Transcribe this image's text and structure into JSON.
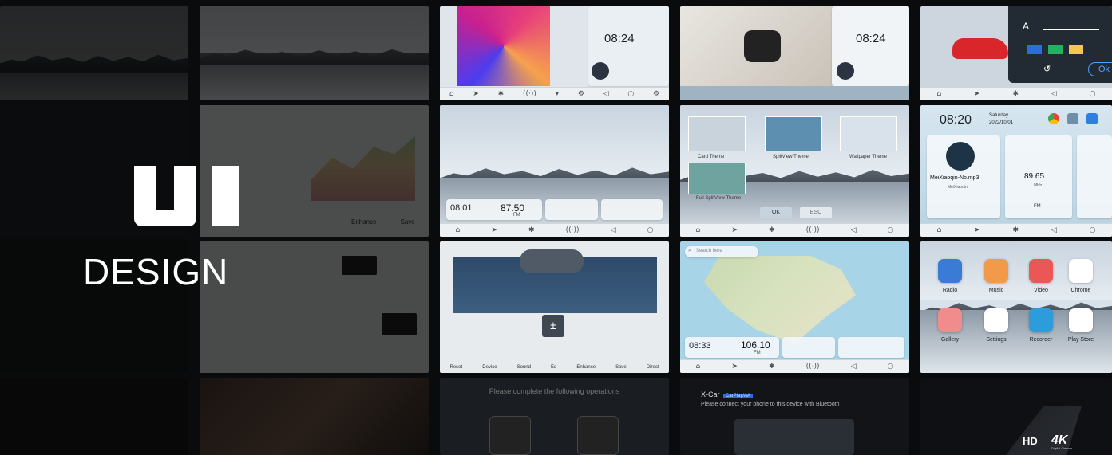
{
  "hero": {
    "title_main": "UI",
    "title_sub": "DESIGN"
  },
  "tiles": {
    "clock_a": "08:24",
    "clock_b": "08:24",
    "eq_labels": [
      "Enhance",
      "Save",
      "Eq"
    ],
    "radio_clock": "08:01",
    "radio_freq": "87.50",
    "radio_band": "FM",
    "themes": {
      "card_theme": "Card Theme",
      "split_theme": "SplitView Theme",
      "wallpaper_theme": "Wallpaper Theme",
      "full_split": "Full SplitView Theme",
      "ok": "OK",
      "esc": "ESC"
    },
    "home": {
      "clock": "08:20",
      "day": "Saturday",
      "date": "2022/10/01",
      "song": "MeiXiaoqin-No.mp3",
      "artist": "MeiXiaoqin",
      "freq": "89.65",
      "unit": "MHz",
      "band": "FM"
    },
    "sound_buttons": [
      "Reset",
      "Device",
      "Sound",
      "Eq",
      "Enhance",
      "Save",
      "Direct"
    ],
    "map": {
      "search": "Search here",
      "clock": "08:33",
      "freq": "106.10",
      "band": "FM"
    },
    "launcher": {
      "apps": [
        {
          "label": "Radio",
          "color": "#3a7bd5",
          "icon": "radio-icon"
        },
        {
          "label": "Music",
          "color": "#f2994a",
          "icon": "music-icon"
        },
        {
          "label": "Video",
          "color": "#eb5757",
          "icon": "video-icon"
        },
        {
          "label": "Chrome",
          "color": "#ffffff",
          "icon": "chrome-icon"
        },
        {
          "label": "Gallery",
          "color": "#f08c8c",
          "icon": "gallery-icon"
        },
        {
          "label": "Settings",
          "color": "#ffffff",
          "icon": "settings-icon"
        },
        {
          "label": "Recorder",
          "color": "#2d9cdb",
          "icon": "recorder-icon"
        },
        {
          "label": "Play Store",
          "color": "#ffffff",
          "icon": "playstore-icon"
        }
      ]
    },
    "operations_prompt": "Please complete the following operations",
    "xcar": {
      "title": "X-Car",
      "tag": "CarPlay/AA",
      "subtitle": "Please connect your phone to this device with Bluetooth"
    },
    "settings_popup": {
      "text_icon": "A",
      "ok": "Ok"
    }
  },
  "brand": {
    "badge_4k": "4K",
    "badge_sub": "Digital Cinema",
    "hd": "HD"
  }
}
